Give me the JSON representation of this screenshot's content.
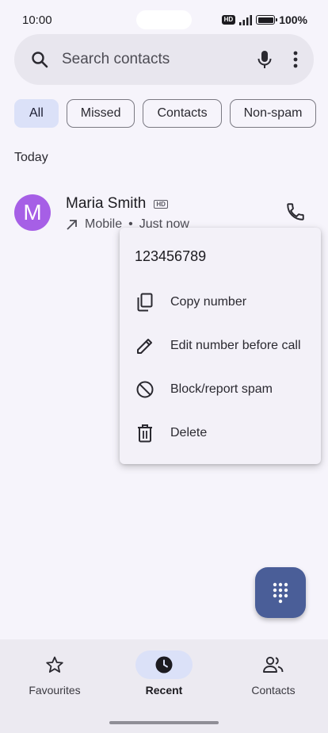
{
  "status_bar": {
    "time": "10:00",
    "hd": "HD",
    "battery_text": "100%"
  },
  "search": {
    "placeholder": "Search contacts"
  },
  "chips": [
    "All",
    "Missed",
    "Contacts",
    "Non-spam"
  ],
  "section_label": "Today",
  "call_log": [
    {
      "avatar_letter": "M",
      "name": "Maria Smith",
      "hd": "HD",
      "type": "Mobile",
      "separator": "•",
      "time": "Just now"
    }
  ],
  "context_menu": {
    "number": "123456789",
    "items": [
      {
        "label": "Copy number",
        "icon": "copy-icon"
      },
      {
        "label": "Edit number before call",
        "icon": "pencil-icon"
      },
      {
        "label": "Block/report spam",
        "icon": "block-icon"
      },
      {
        "label": "Delete",
        "icon": "trash-icon"
      }
    ]
  },
  "bottom_nav": [
    {
      "label": "Favourites",
      "icon": "star-icon"
    },
    {
      "label": "Recent",
      "icon": "clock-icon"
    },
    {
      "label": "Contacts",
      "icon": "people-icon"
    }
  ],
  "colors": {
    "accent": "#4a5e98",
    "avatar": "#a65fe6",
    "chip_active": "#dbe1f8"
  }
}
